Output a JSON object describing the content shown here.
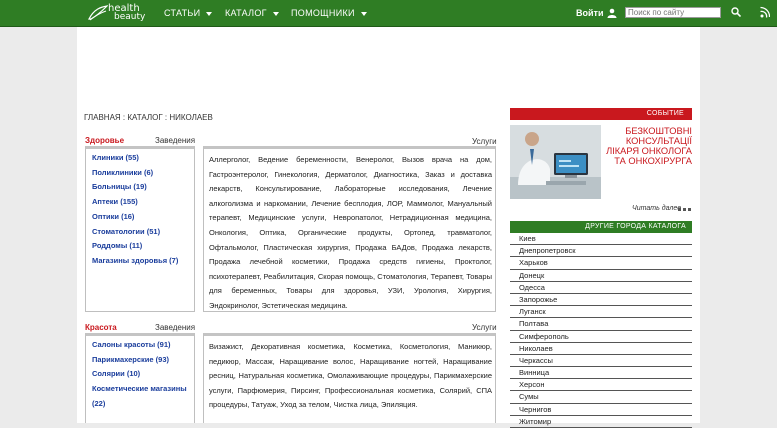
{
  "header": {
    "logo": {
      "line1": "health",
      "line2": "beauty"
    },
    "nav": [
      "СТАТЬИ",
      "КАТАЛОГ",
      "ПОМОЩНИКИ"
    ],
    "login_label": "Войти",
    "search_placeholder": "Поиск по сайту"
  },
  "breadcrumb": "ГЛАВНАЯ : КАТАЛОГ : НИКОЛАЕВ",
  "sections": [
    {
      "title": "Здоровье",
      "tab_establishments": "Заведения",
      "tab_services": "Услуги",
      "categories": [
        "Клиники (55)",
        "Поликлиники (6)",
        "Больницы (19)",
        "Аптеки (155)",
        "Оптики (16)",
        "Стоматологии (51)",
        "Роддомы (11)",
        "Магазины здоровья (7)"
      ],
      "services": "Аллерголог, Ведение беременности, Венеролог, Вызов врача на дом, Гастроэнтеролог, Гинекология, Дерматолог, Диагностика, Заказ и доставка лекарств, Консультирование, Лабораторные исследования, Лечение алкоголизма и наркомании, Лечение бесплодия, ЛОР, Маммолог, Мануальный терапевт, Медицинские услуги, Невропатолог, Нетрадиционная медицина, Онкология, Оптика, Органические продукты, Ортопед, травматолог, Офтальмолог, Пластическая хирургия, Продажа БАДов, Продажа лекарств, Продажа лечебной косметики, Продажа средств гигиены, Проктолог, психотерапевт, Реабилитация, Скорая помощь, Стоматология, Терапевт, Товары для беременных, Товары для здоровья, УЗИ, Урология, Хирургия, Эндокринолог, Эстетическая медицина."
    },
    {
      "title": "Красота",
      "tab_establishments": "Заведения",
      "tab_services": "Услуги",
      "categories": [
        "Салоны красоты (91)",
        "Парикмахерские (93)",
        "Солярии (10)",
        "Косметические магазины (22)"
      ],
      "services": "Визажист, Декоративная косметика, Косметика, Косметология, Маникюр, педикюр, Массаж, Наращивание волос, Наращивание ногтей, Наращивание ресниц, Натуральная косметика, Омолаживающие процедуры, Парикмахерские услуги, Парфюмерия, Пирсинг, Профессиональная косметика, Солярий, СПА процедуры, Татуаж, Уход за телом, Чистка лица, Эпиляция."
    }
  ],
  "event": {
    "header": "СОБЫТИЕ",
    "text": [
      "БЕЗКОШТОВНІ",
      "КОНСУЛЬТАЦІЇ",
      "ЛІКАРЯ ОНКОЛОГА",
      "ТА ОНКОХІРУРГА"
    ],
    "more_label": "Читать далее"
  },
  "cities": {
    "header": "ДРУГИЕ ГОРОДА КАТАЛОГА",
    "items": [
      "Киев",
      "Днепропетровск",
      "Харьков",
      "Донецк",
      "Одесса",
      "Запорожье",
      "Луганск",
      "Полтава",
      "Симферополь",
      "Николаев",
      "Черкассы",
      "Винница",
      "Херсон",
      "Сумы",
      "Чернигов",
      "Житомир"
    ]
  },
  "colors": {
    "brand_green": "#2f7d24",
    "accent_red": "#c9181e",
    "link_blue": "#1a3d9c"
  }
}
